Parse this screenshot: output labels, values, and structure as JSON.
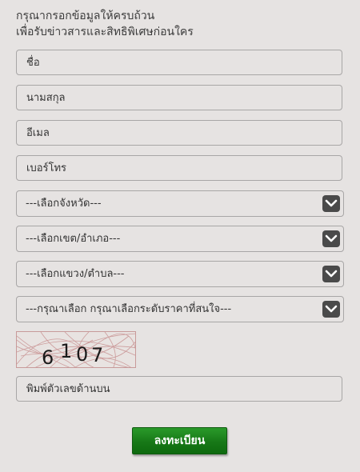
{
  "heading": {
    "line1": "กรุณากรอกข้อมูลให้ครบถ้วน",
    "line2": "เพื่อรับข่าวสารและสิทธิพิเศษก่อนใคร"
  },
  "form": {
    "name_placeholder": "ชื่อ",
    "surname_placeholder": "นามสกุล",
    "email_placeholder": "อีเมล",
    "phone_placeholder": "เบอร์โทร",
    "province_select": "---เลือกจังหวัด---",
    "district_select": "---เลือกเขต/อำเภอ---",
    "subdistrict_select": "---เลือกแขวง/ตำบล---",
    "price_select": "---กรุณาเลือก กรุณาเลือกระดับราคาที่สนใจ---",
    "captcha_code": [
      "6",
      "1",
      "0",
      "7"
    ],
    "captcha_input_placeholder": "พิมพ์ตัวเลขด้านบน",
    "submit_label": "ลงทะเบียน"
  },
  "colors": {
    "background": "#e6e3e2",
    "field_border": "#a8a6a6",
    "select_button": "#4a4a4a",
    "submit_green": "#177817"
  },
  "icons": {
    "select_toggle": "chevron-down-icon"
  }
}
